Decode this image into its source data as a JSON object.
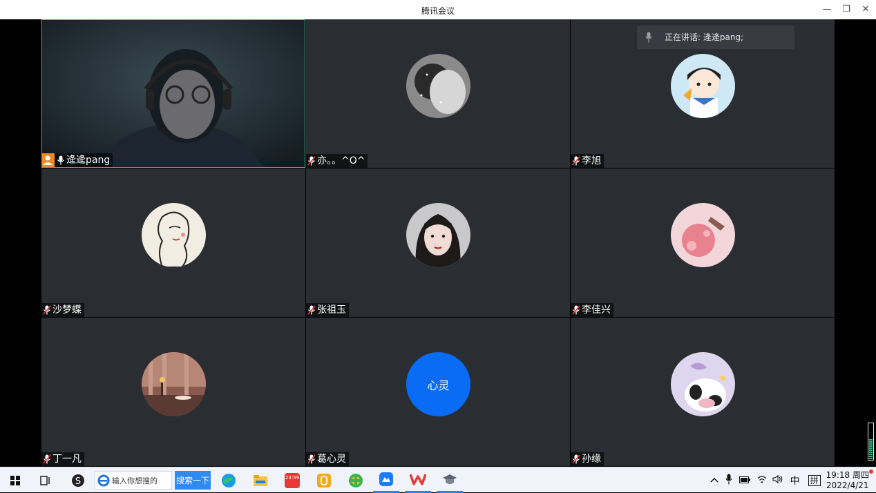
{
  "window": {
    "title": "腾讯会议",
    "minimize_glyph": "—",
    "restore_glyph": "❐",
    "close_glyph": "✕"
  },
  "speaking_indicator": {
    "label": "正在讲话: 逄逄pang;"
  },
  "participants": [
    {
      "name": "逄逄pang",
      "is_host": true,
      "video_on": true,
      "mic": "on"
    },
    {
      "name": "亦。。^O^",
      "mic": "muted"
    },
    {
      "name": "李旭",
      "mic": "muted"
    },
    {
      "name": "沙梦蝶",
      "mic": "muted"
    },
    {
      "name": "张祖玉",
      "mic": "muted"
    },
    {
      "name": "李佳兴",
      "mic": "muted"
    },
    {
      "name": "丁一凡",
      "mic": "muted"
    },
    {
      "name": "葛心灵",
      "mic": "muted",
      "avatar_text": "心灵",
      "avatar_color": "#0a6cf5"
    },
    {
      "name": "孙缘",
      "mic": "muted"
    }
  ],
  "taskbar": {
    "search_placeholder": "输入你想搜的",
    "search_button": "搜索一下",
    "app_badge": "23:59",
    "ime_mode": "中",
    "ime_pinyin": "拼",
    "time": "19:18 周四",
    "date": "2022/4/21"
  },
  "colors": {
    "tile_bg": "#2a2d31",
    "host_badge": "#f08a24",
    "active_speaker_border": "#2ec27e",
    "taskbar_bg": "#f0f3f9"
  }
}
